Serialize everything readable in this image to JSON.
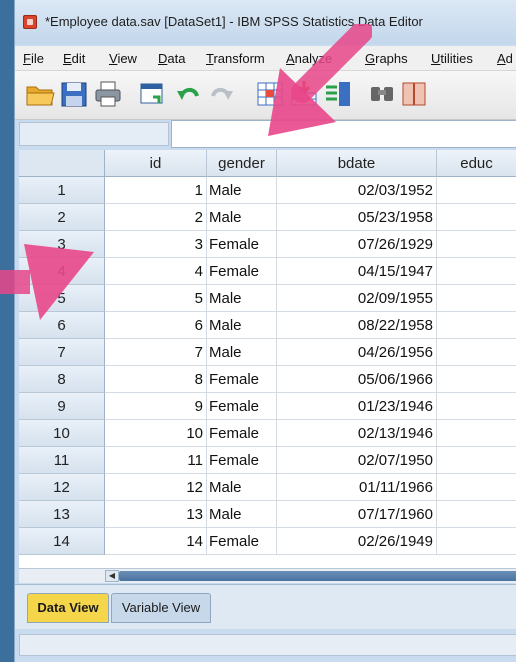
{
  "window": {
    "title": "*Employee data.sav [DataSet1] - IBM SPSS Statistics Data Editor"
  },
  "menu": [
    "File",
    "Edit",
    "View",
    "Data",
    "Transform",
    "Analyze",
    "Graphs",
    "Utilities",
    "Ad"
  ],
  "toolbar": {
    "icons": [
      "open-folder-icon",
      "save-icon",
      "print-icon",
      "recall-dialog-icon",
      "undo-icon",
      "redo-icon",
      "goto-case-icon",
      "insert-cases-icon",
      "variables-icon",
      "find-icon",
      "split-icon"
    ]
  },
  "grid": {
    "columns": [
      "id",
      "gender",
      "bdate",
      "educ"
    ],
    "rows": [
      {
        "n": "1",
        "id": "1",
        "gender": "Male",
        "bdate": "02/03/1952"
      },
      {
        "n": "2",
        "id": "2",
        "gender": "Male",
        "bdate": "05/23/1958"
      },
      {
        "n": "3",
        "id": "3",
        "gender": "Female",
        "bdate": "07/26/1929"
      },
      {
        "n": "4",
        "id": "4",
        "gender": "Female",
        "bdate": "04/15/1947"
      },
      {
        "n": "5",
        "id": "5",
        "gender": "Male",
        "bdate": "02/09/1955"
      },
      {
        "n": "6",
        "id": "6",
        "gender": "Male",
        "bdate": "08/22/1958"
      },
      {
        "n": "7",
        "id": "7",
        "gender": "Male",
        "bdate": "04/26/1956"
      },
      {
        "n": "8",
        "id": "8",
        "gender": "Female",
        "bdate": "05/06/1966"
      },
      {
        "n": "9",
        "id": "9",
        "gender": "Female",
        "bdate": "01/23/1946"
      },
      {
        "n": "10",
        "id": "10",
        "gender": "Female",
        "bdate": "02/13/1946"
      },
      {
        "n": "11",
        "id": "11",
        "gender": "Female",
        "bdate": "02/07/1950"
      },
      {
        "n": "12",
        "id": "12",
        "gender": "Male",
        "bdate": "01/11/1966"
      },
      {
        "n": "13",
        "id": "13",
        "gender": "Male",
        "bdate": "07/17/1960"
      },
      {
        "n": "14",
        "id": "14",
        "gender": "Female",
        "bdate": "02/26/1949"
      }
    ]
  },
  "tabs": {
    "data_view": "Data View",
    "variable_view": "Variable View"
  },
  "colors": {
    "active_tab": "#f5d64b",
    "annotation_arrow": "#e8478a",
    "accent": "#4a73a0"
  }
}
